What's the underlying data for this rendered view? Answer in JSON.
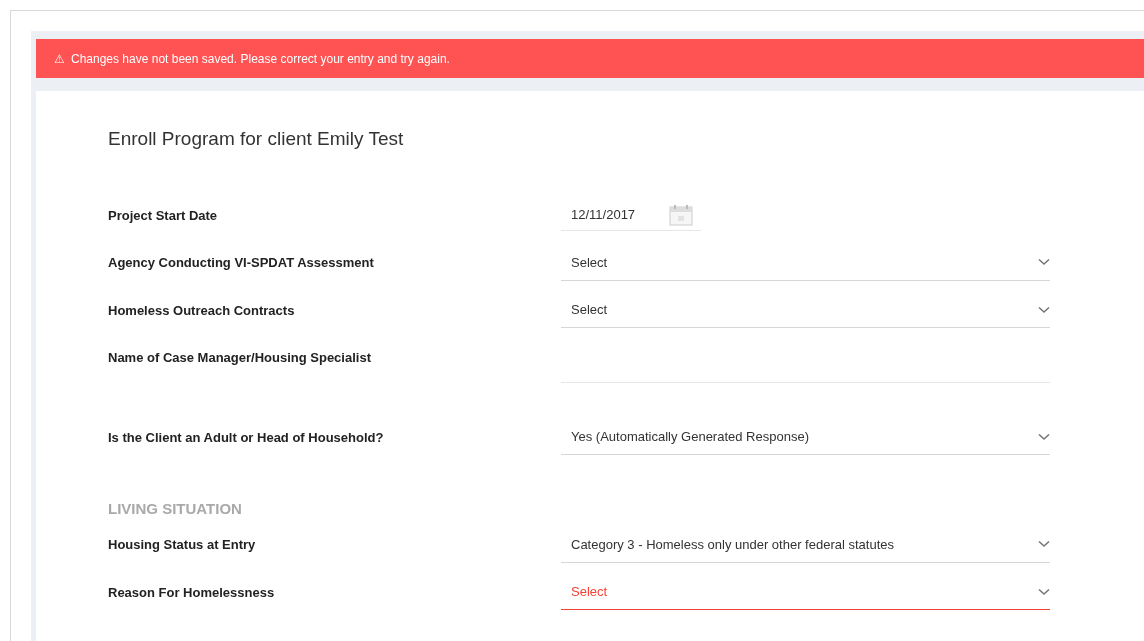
{
  "alert": {
    "icon": "⚠",
    "message": "Changes have not been saved. Please correct your entry and try again."
  },
  "form": {
    "title": "Enroll Program for client Emily Test",
    "items": [
      {
        "kind": "date",
        "label": "Project Start Date",
        "value": "12/11/2017"
      },
      {
        "kind": "select",
        "label": "Agency Conducting VI-SPDAT Assessment",
        "value": "Select",
        "invalid": false
      },
      {
        "kind": "select",
        "label": "Homeless Outreach Contracts",
        "value": "Select",
        "invalid": false
      },
      {
        "kind": "text",
        "label": "Name of Case Manager/Housing Specialist"
      },
      {
        "kind": "select",
        "label": "Is the Client an Adult or Head of Household?",
        "value": "Yes (Automatically Generated Response)",
        "invalid": false
      },
      {
        "kind": "section",
        "label": "LIVING SITUATION"
      },
      {
        "kind": "select",
        "label": "Housing Status at Entry",
        "value": "Category 3 - Homeless only under other federal statutes",
        "invalid": false
      },
      {
        "kind": "select",
        "label": "Reason For Homelessness",
        "value": "Select",
        "invalid": true
      }
    ]
  }
}
